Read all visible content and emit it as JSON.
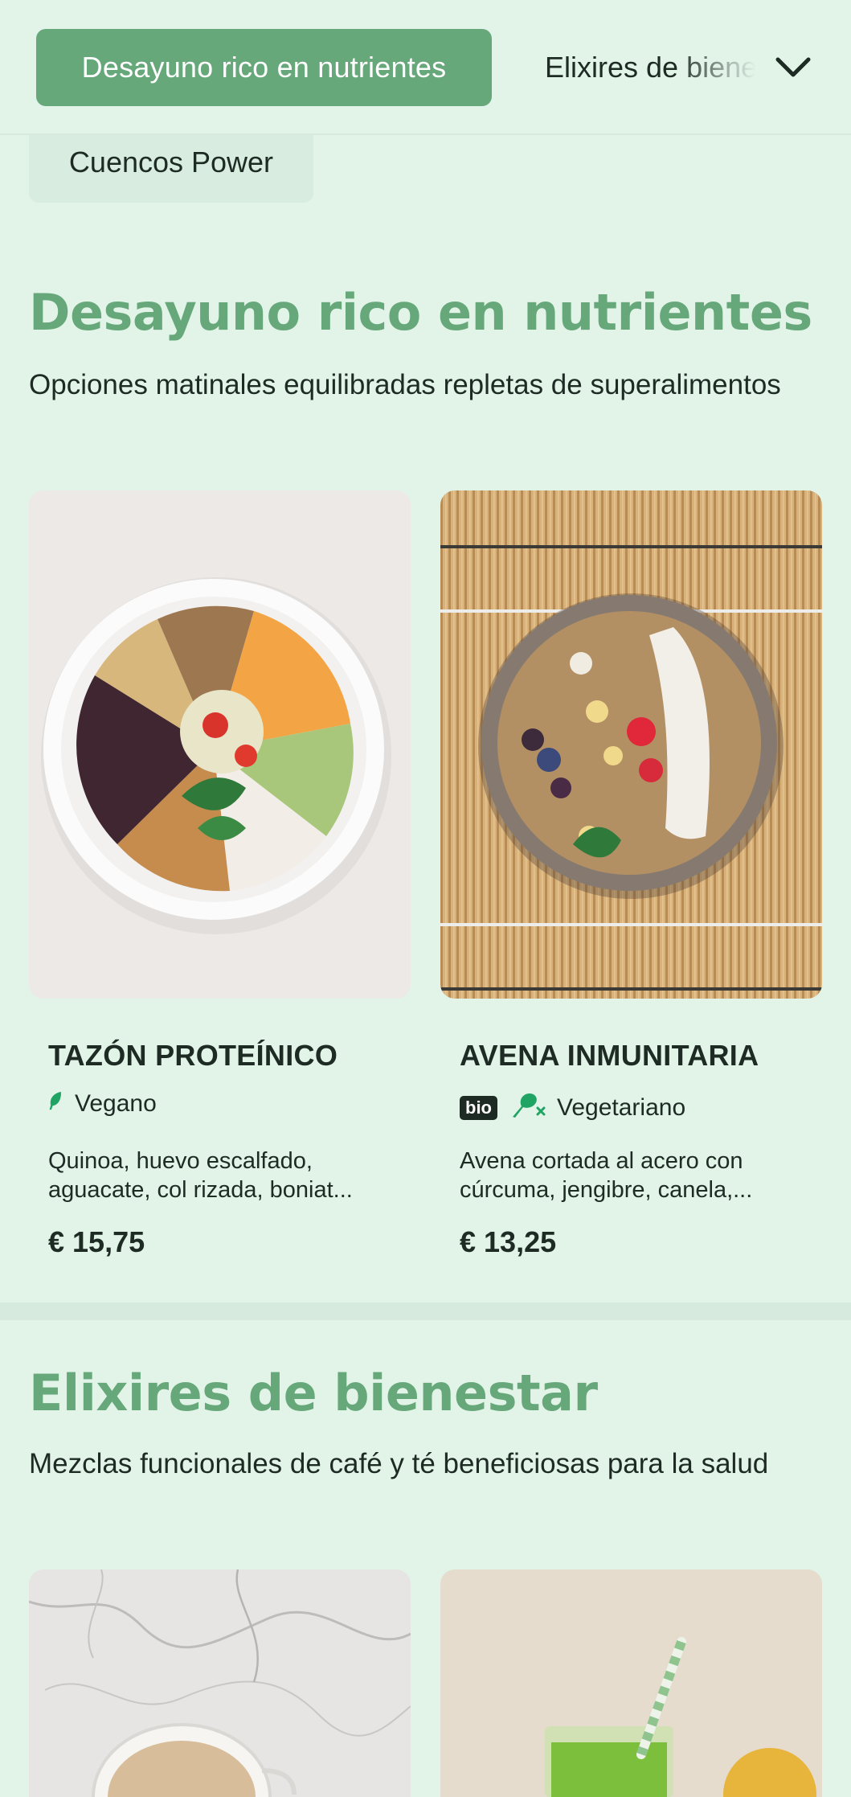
{
  "tabs": {
    "active": "Desayuno rico en nutrientes",
    "next": "Elixires de bienestar",
    "wrapped": "Cuencos Power"
  },
  "sections": [
    {
      "title": "Desayuno rico en nutrientes",
      "subtitle": "Opciones matinales equilibradas repletas de superalimentos",
      "items": [
        {
          "name": "TAZÓN PROTEÍNICO",
          "diet": "Vegano",
          "diet_icon": "leaf-icon",
          "desc_line1": "Quinoa, huevo escalfado,",
          "desc_line2": "aguacate, col rizada, boniat...",
          "price": "€ 15,75"
        },
        {
          "name": "AVENA INMUNITARIA",
          "badge": "bio",
          "diet": "Vegetariano",
          "diet_icon": "no-meat-icon",
          "desc_line1": "Avena cortada al acero con",
          "desc_line2": "cúrcuma, jengibre, canela,...",
          "price": "€ 13,25"
        }
      ]
    },
    {
      "title": "Elixires de bienestar",
      "subtitle": "Mezclas funcionales de café y té beneficiosas para la salud"
    }
  ],
  "colors": {
    "accent": "#66a87a",
    "background": "#e2f3e8",
    "text": "#1d2b24",
    "divider": "#d6ebdd"
  }
}
